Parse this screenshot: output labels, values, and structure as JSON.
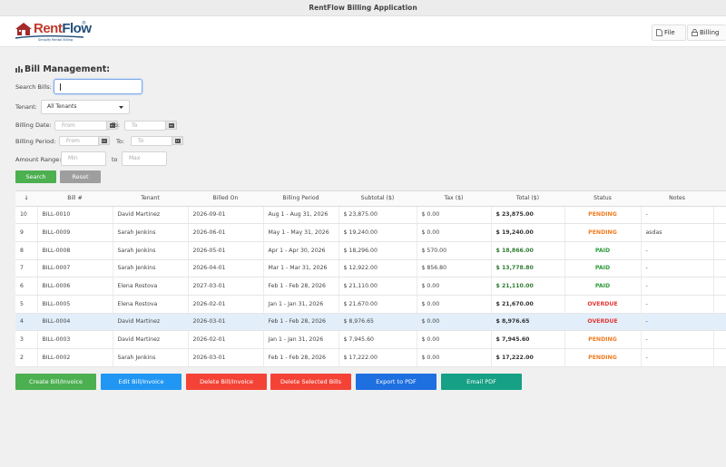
{
  "window": {
    "title": "RentFlow Billing Application"
  },
  "logo": {
    "brand_part1": "Rent",
    "brand_part2": "Flow",
    "reg": "®",
    "tagline": "Simplify Rental Billing"
  },
  "menu": {
    "file": "File",
    "billing": "Billing"
  },
  "section": {
    "title": "Bill Management:"
  },
  "filters": {
    "search_label": "Search Bills:",
    "search_value": "",
    "tenant_label": "Tenant:",
    "tenant_value": "All Tenants",
    "billing_date_label": "Billing Date:",
    "billing_period_label": "Billing Period:",
    "amount_range_label": "Amount Range:",
    "from_placeholder": "From",
    "to_label": "To:",
    "to_placeholder": "To",
    "to_word": "to",
    "min_placeholder": "Min",
    "max_placeholder": "Max",
    "search_button": "Search",
    "reset_button": "Reset"
  },
  "table": {
    "sort_indicator": "↓",
    "columns": [
      "Bill #",
      "Tenant",
      "Billed On",
      "Billing Period",
      "Subtotal ($)",
      "Tax ($)",
      "Total ($)",
      "Status",
      "Notes"
    ],
    "rows": [
      {
        "id": "10",
        "bill": "BILL-0010",
        "tenant": "David Martinez",
        "billed_on": "2026-09-01",
        "period": "Aug 1 - Aug 31, 2026",
        "subtotal": "$ 23,875.00",
        "tax": "$ 0.00",
        "total": "$ 23,875.00",
        "status": "PENDING",
        "notes": "-"
      },
      {
        "id": "9",
        "bill": "BILL-0009",
        "tenant": "Sarah Jenkins",
        "billed_on": "2026-06-01",
        "period": "May 1 - May 31, 2026",
        "subtotal": "$ 19,240.00",
        "tax": "$ 0.00",
        "total": "$ 19,240.00",
        "status": "PENDING",
        "notes": "asdas"
      },
      {
        "id": "8",
        "bill": "BILL-0008",
        "tenant": "Sarah Jenkins",
        "billed_on": "2026-05-01",
        "period": "Apr 1 - Apr 30, 2026",
        "subtotal": "$ 18,296.00",
        "tax": "$ 570.00",
        "total": "$ 18,866.00",
        "status": "PAID",
        "notes": "-"
      },
      {
        "id": "7",
        "bill": "BILL-0007",
        "tenant": "Sarah Jenkins",
        "billed_on": "2026-04-01",
        "period": "Mar 1 - Mar 31, 2026",
        "subtotal": "$ 12,922.00",
        "tax": "$ 856.80",
        "total": "$ 13,778.80",
        "status": "PAID",
        "notes": "-"
      },
      {
        "id": "6",
        "bill": "BILL-0006",
        "tenant": "Elena Rostova",
        "billed_on": "2027-03-01",
        "period": "Feb 1 - Feb 28, 2026",
        "subtotal": "$ 21,110.00",
        "tax": "$ 0.00",
        "total": "$ 21,110.00",
        "status": "PAID",
        "notes": "-"
      },
      {
        "id": "5",
        "bill": "BILL-0005",
        "tenant": "Elena Rostova",
        "billed_on": "2026-02-01",
        "period": "Jan 1 - Jan 31, 2026",
        "subtotal": "$ 21,670.00",
        "tax": "$ 0.00",
        "total": "$ 21,670.00",
        "status": "OVERDUE",
        "notes": "-"
      },
      {
        "id": "4",
        "bill": "BILL-0004",
        "tenant": "David Martinez",
        "billed_on": "2026-03-01",
        "period": "Feb 1 - Feb 28, 2026",
        "subtotal": "$ 8,976.65",
        "tax": "$ 0.00",
        "total": "$ 8,976.65",
        "status": "OVERDUE",
        "notes": "-",
        "selected": true
      },
      {
        "id": "3",
        "bill": "BILL-0003",
        "tenant": "David Martinez",
        "billed_on": "2026-02-01",
        "period": "Jan 1 - Jan 31, 2026",
        "subtotal": "$ 7,945.60",
        "tax": "$ 0.00",
        "total": "$ 7,945.60",
        "status": "PENDING",
        "notes": "-"
      },
      {
        "id": "2",
        "bill": "BILL-0002",
        "tenant": "Sarah Jenkins",
        "billed_on": "2026-03-01",
        "period": "Feb 1 - Feb 28, 2026",
        "subtotal": "$ 17,222.00",
        "tax": "$ 0.00",
        "total": "$ 17,222.00",
        "status": "PENDING",
        "notes": "-"
      }
    ]
  },
  "actions": [
    {
      "label": "Create Bill/Invoice",
      "color": "#4caf50"
    },
    {
      "label": "Edit Bill/Invoice",
      "color": "#2196f3"
    },
    {
      "label": "Delete Bill/Invoice",
      "color": "#f44336"
    },
    {
      "label": "Delete Selected Bills",
      "color": "#f44336"
    },
    {
      "label": "Export to PDF",
      "color": "#1e6fe0"
    },
    {
      "label": "Email PDF",
      "color": "#16a085"
    }
  ],
  "colors": {
    "pending": "#f07c20",
    "paid": "#2e9b3a",
    "overdue": "#e53935",
    "selected_row": "#e2eefa"
  }
}
